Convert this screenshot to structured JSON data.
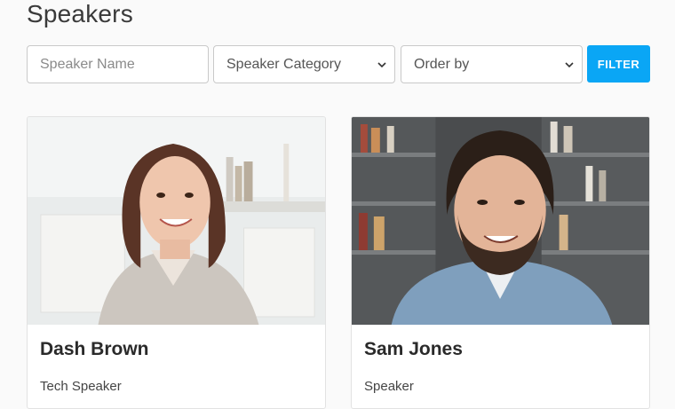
{
  "page": {
    "title": "Speakers"
  },
  "filters": {
    "name_placeholder": "Speaker Name",
    "category_selected": "Speaker Category",
    "order_selected": "Order by",
    "filter_label": "FILTER",
    "accent": "#0aa6f5"
  },
  "speakers": [
    {
      "name": "Dash Brown",
      "category": "Tech Speaker",
      "photo_icon": "woman-portrait-photo"
    },
    {
      "name": "Sam Jones",
      "category": "Speaker",
      "photo_icon": "man-portrait-photo"
    }
  ]
}
